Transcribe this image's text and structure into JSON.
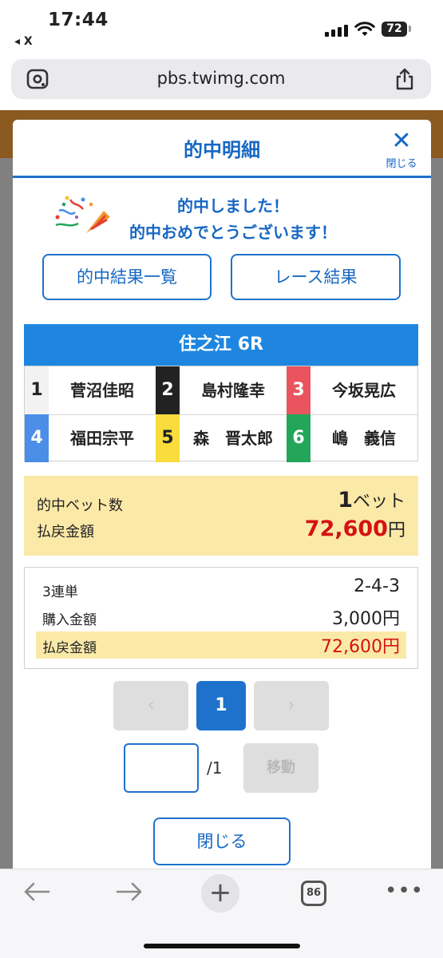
{
  "status_bar": {
    "time": "17:44",
    "back_app": "◂ X",
    "battery": "72"
  },
  "browser": {
    "url": "pbs.twimg.com",
    "tab_count": "86"
  },
  "modal": {
    "title": "的中明細",
    "close_label": "閉じる",
    "message_line1": "的中しました！",
    "message_line2": "的中おめでとうございます！",
    "results_list_button": "的中結果一覧",
    "race_result_button": "レース結果",
    "race_title": "住之江 6R",
    "racers": [
      {
        "num": "1",
        "name": "菅沼佳昭",
        "bg": "#f2f2f2",
        "fg": "#222222"
      },
      {
        "num": "2",
        "name": "島村隆幸",
        "bg": "#222222",
        "fg": "#ffffff"
      },
      {
        "num": "3",
        "name": "今坂晃広",
        "bg": "#e9545f",
        "fg": "#ffffff"
      },
      {
        "num": "4",
        "name": "福田宗平",
        "bg": "#4a8ee8",
        "fg": "#ffffff"
      },
      {
        "num": "5",
        "name": "森　晋太郎",
        "bg": "#f8dd3c",
        "fg": "#222222"
      },
      {
        "num": "6",
        "name": "嶋　義信",
        "bg": "#23a65a",
        "fg": "#ffffff"
      }
    ],
    "summary": {
      "bet_count_label": "的中ベット数",
      "bet_count_value": "1",
      "bet_count_unit": "ベット",
      "payout_label": "払戻金額",
      "payout_value": "72,600",
      "payout_unit": "円"
    },
    "detail": {
      "bet_type_label": "3連単",
      "bet_type_value": "2-4-3",
      "purchase_label": "購入金額",
      "purchase_value": "3,000円",
      "payout_label": "払戻金額",
      "payout_value": "72,600円"
    },
    "pager": {
      "prev": "‹",
      "current": "1",
      "next": "›",
      "page_input_value": "",
      "total": "/1",
      "move_button": "移動"
    },
    "close_button": "閉じる"
  }
}
